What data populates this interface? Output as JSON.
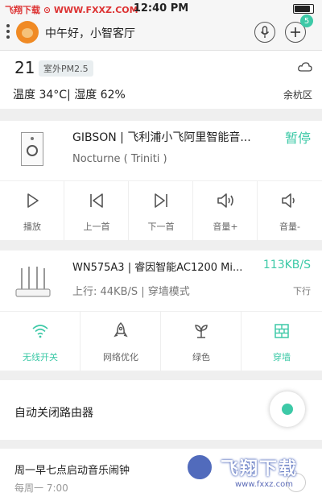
{
  "status_bar": {
    "left_text": "飞翔下载 ⊙ WWW.FXXZ.COM",
    "time": "12:40 PM"
  },
  "header": {
    "greeting": "中午好，小智客厅",
    "badge_count": "5"
  },
  "weather": {
    "temp": "21",
    "pm_label": "室外PM2.5",
    "detail": "温度 34°C| 湿度 62%",
    "district": "余杭区"
  },
  "speaker": {
    "name": "GIBSON | 飞利浦小飞阿里智能音...",
    "action": "暂停",
    "track": "Nocturne ( Triniti )",
    "controls": [
      {
        "label": "播放",
        "icon": "play-icon"
      },
      {
        "label": "上一首",
        "icon": "previous-icon"
      },
      {
        "label": "下一首",
        "icon": "next-icon"
      },
      {
        "label": "音量+",
        "icon": "volume-up-icon"
      },
      {
        "label": "音量-",
        "icon": "volume-down-icon"
      }
    ]
  },
  "router": {
    "name": "WN575A3 | 睿因智能AC1200 Mi...",
    "speed": "113KB/S",
    "upload": "上行: 44KB/S | 穿墙模式",
    "download": "下行",
    "features": [
      {
        "label": "无线开关",
        "icon": "wifi-icon",
        "active": true
      },
      {
        "label": "网络优化",
        "icon": "rocket-icon",
        "active": false
      },
      {
        "label": "绿色",
        "icon": "sprout-icon",
        "active": false
      },
      {
        "label": "穿墙",
        "icon": "wall-icon",
        "active": true
      }
    ]
  },
  "auto_close": {
    "label": "自动关闭路由器",
    "enabled": true
  },
  "alarm": {
    "title": "周一早七点启动音乐闹钟",
    "schedule": "每周一 7:00"
  },
  "watermark": {
    "text": "飞翔下载",
    "url": "www.fxxz.com"
  },
  "colors": {
    "accent": "#3dc9a7",
    "background": "#efefef"
  }
}
